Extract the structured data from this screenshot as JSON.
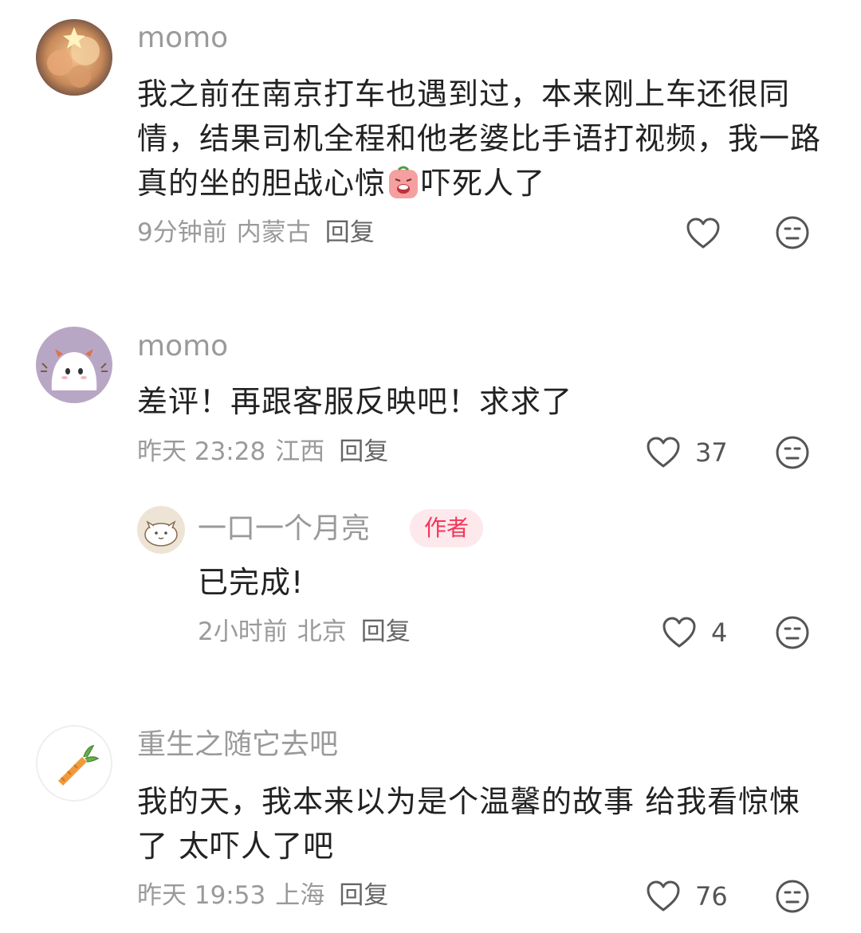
{
  "colors": {
    "meta_gray": "#9a9a9a",
    "text": "#222222",
    "author_tag_bg": "#fde8ec",
    "author_tag_text": "#f2355a"
  },
  "comments": [
    {
      "username": "momo",
      "text_before_emoji": "我之前在南京打车也遇到过，本来刚上车还很同情，结果司机全程和他老婆比手语打视频，我一路真的坐的胆战心惊",
      "emoji": "scared-face-emoji",
      "text_after_emoji": "吓死人了",
      "time": "9分钟前",
      "location": "内蒙古",
      "reply_label": "回复",
      "like_count": ""
    },
    {
      "username": "momo",
      "text": "差评！再跟客服反映吧！求求了",
      "time": "昨天 23:28",
      "location": "江西",
      "reply_label": "回复",
      "like_count": "37",
      "replies": [
        {
          "username": "一口一个月亮",
          "tag": "作者",
          "text": "已完成!",
          "time": "2小时前",
          "location": "北京",
          "reply_label": "回复",
          "like_count": "4"
        }
      ]
    },
    {
      "username": "重生之随它去吧",
      "text": "我的天，我本来以为是个温馨的故事 给我看惊悚了 太吓人了吧",
      "time": "昨天 19:53",
      "location": "上海",
      "reply_label": "回复",
      "like_count": "76"
    }
  ]
}
